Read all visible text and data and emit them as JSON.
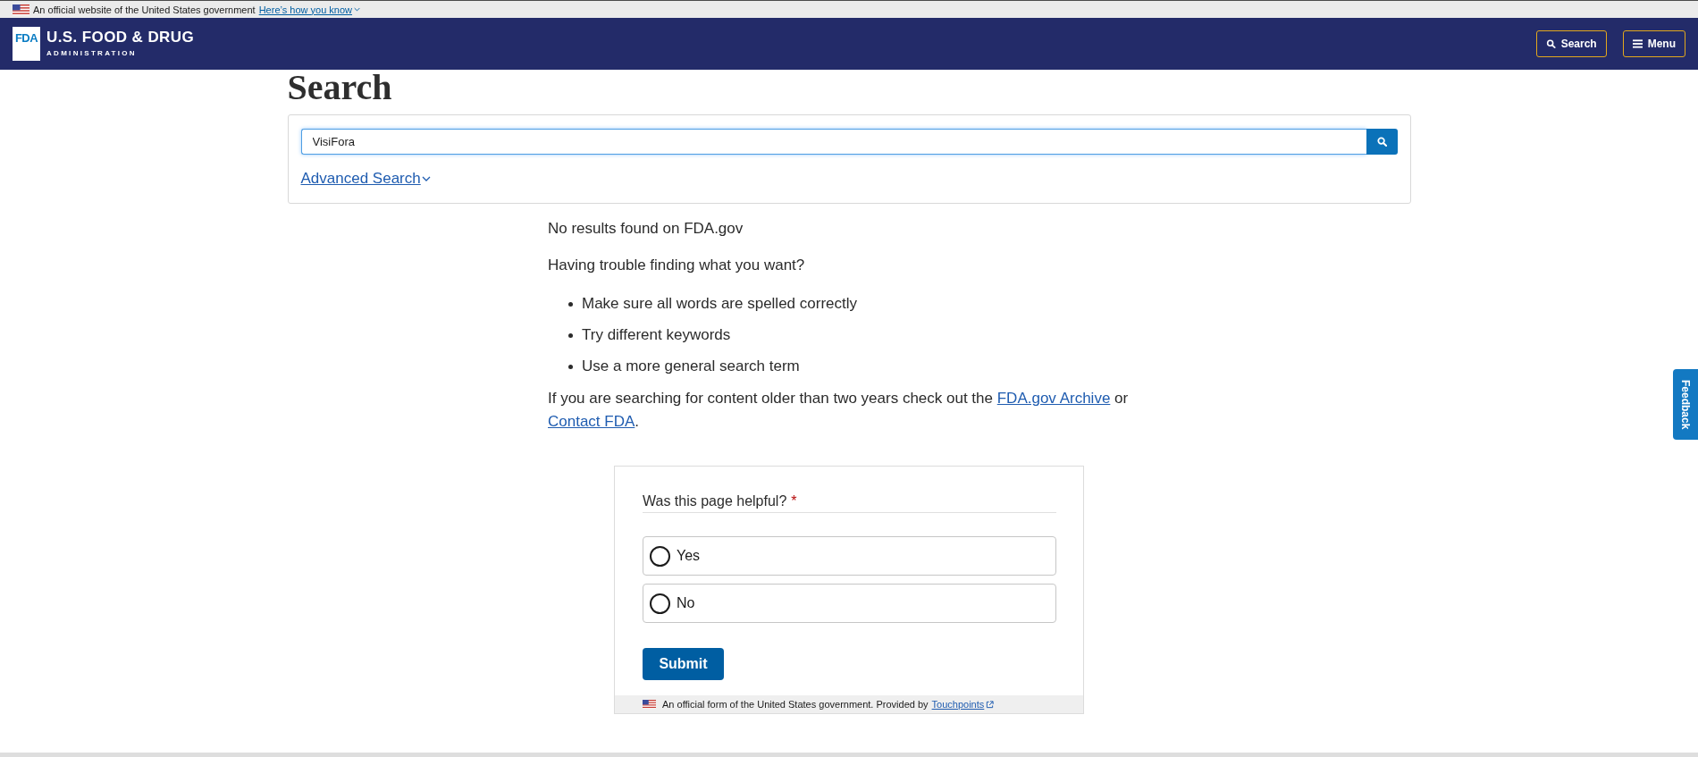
{
  "gov_banner": {
    "text": "An official website of the United States government",
    "link": "Here’s how you know"
  },
  "header": {
    "logo_mark": "FDA",
    "title": "U.S. FOOD & DRUG",
    "subtitle": "ADMINISTRATION",
    "buttons": [
      {
        "label": "Search",
        "kind": "search"
      },
      {
        "label": "Menu",
        "kind": "menu"
      }
    ]
  },
  "page_title": "Search",
  "search": {
    "value": "VisiFora",
    "advanced_link": "Advanced Search"
  },
  "results": {
    "message": "No results found on FDA.gov",
    "help_heading": "Having trouble finding what you want?",
    "tips": [
      "Make sure all words are spelled correctly",
      "Try different keywords",
      "Use a more general search term"
    ],
    "archive_note": {
      "text_before": "If you are searching for content older than two years check out the",
      "archive_link": "FDA.gov Archive",
      "text_middle": "or",
      "contact_link": "Contact FDA",
      "text_after": "."
    }
  },
  "feedback_form": {
    "question": "Was this page helpful?",
    "required_mark": "*",
    "options": [
      {
        "label": "Yes",
        "selected": false
      },
      {
        "label": "No",
        "selected": false
      }
    ],
    "submit": "Submit",
    "footer": {
      "text": "An official form of the United States government. Provided by",
      "link": "Touchpoints"
    }
  },
  "feedback_tab": "Feedback"
}
